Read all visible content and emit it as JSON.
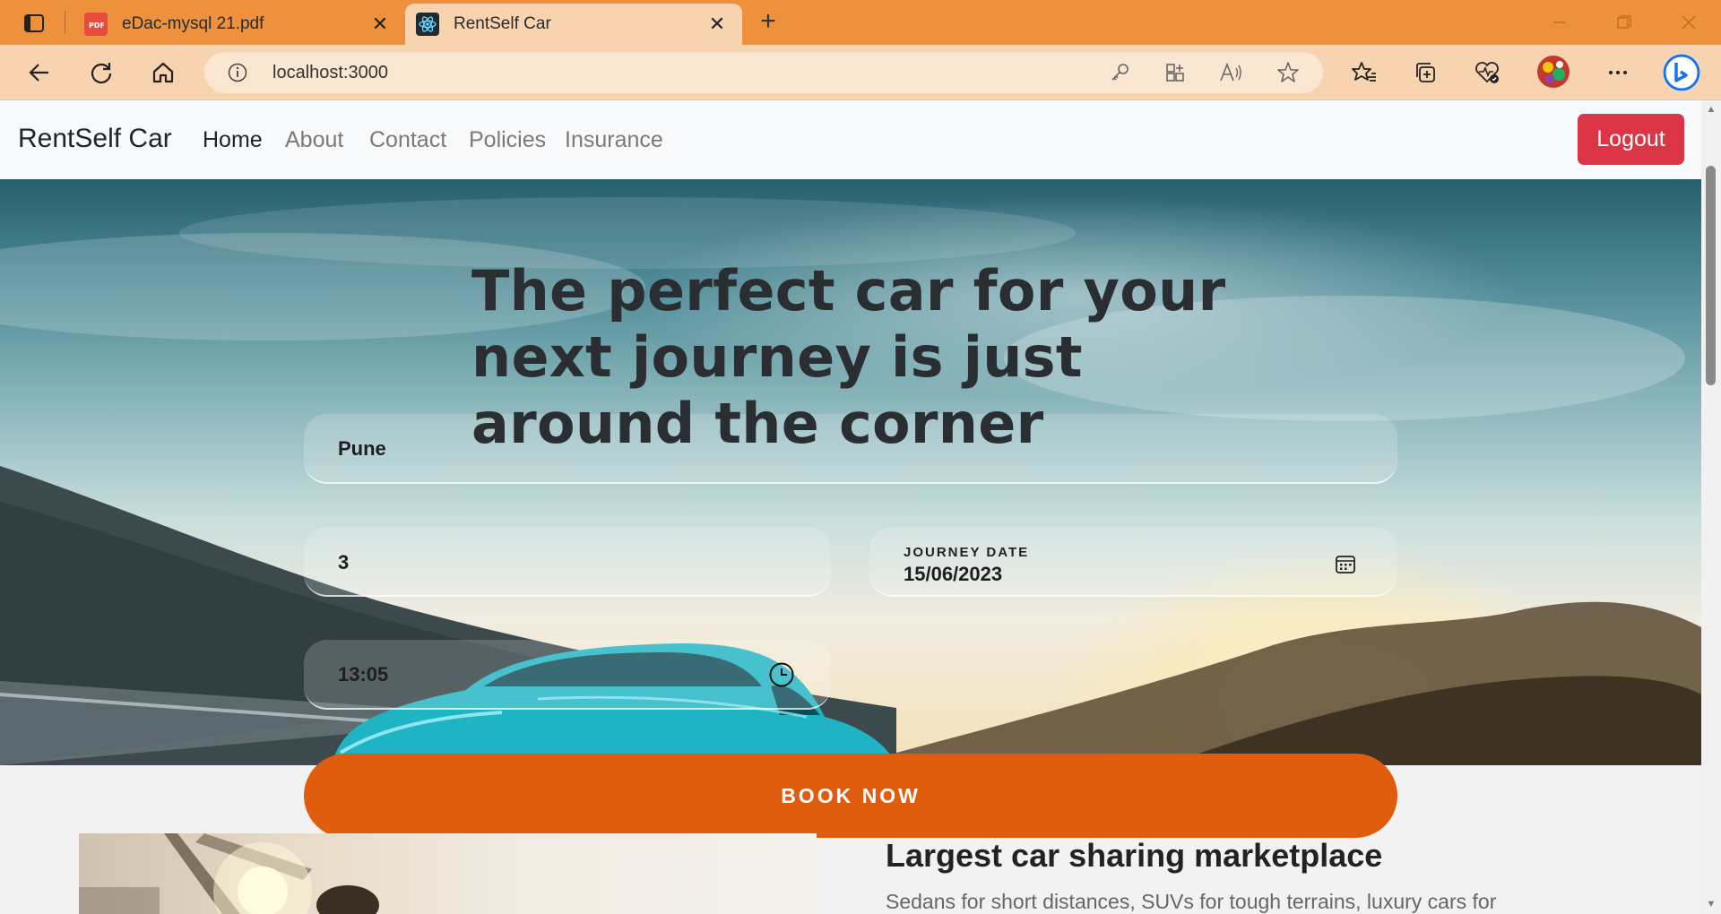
{
  "browser": {
    "tabs": [
      {
        "title": "eDac-mysql 21.pdf",
        "icon": "pdf-icon",
        "active": false
      },
      {
        "title": "RentSelf Car",
        "icon": "react-icon",
        "active": true
      }
    ],
    "url": "localhost:3000",
    "colors": {
      "tabbar": "#ed913c",
      "toolbar": "#f8d3b0"
    }
  },
  "navbar": {
    "brand": "RentSelf Car",
    "links": [
      "Home",
      "About",
      "Contact",
      "Policies",
      "Insurance"
    ],
    "active_link": "Home",
    "logout_label": "Logout",
    "logout_color": "#dc3545"
  },
  "hero": {
    "headline": "The perfect car for your next journey is just around the corner",
    "city_value": "Pune",
    "days_value": "3",
    "journey_date_label": "JOURNEY DATE",
    "journey_date_value": "15/06/2023",
    "time_value": "13:05",
    "book_label": "BOOK NOW",
    "book_color": "#e05c0e"
  },
  "feature": {
    "title": "Largest car sharing marketplace",
    "text": "Sedans for short distances, SUVs for tough terrains, luxury cars for"
  }
}
